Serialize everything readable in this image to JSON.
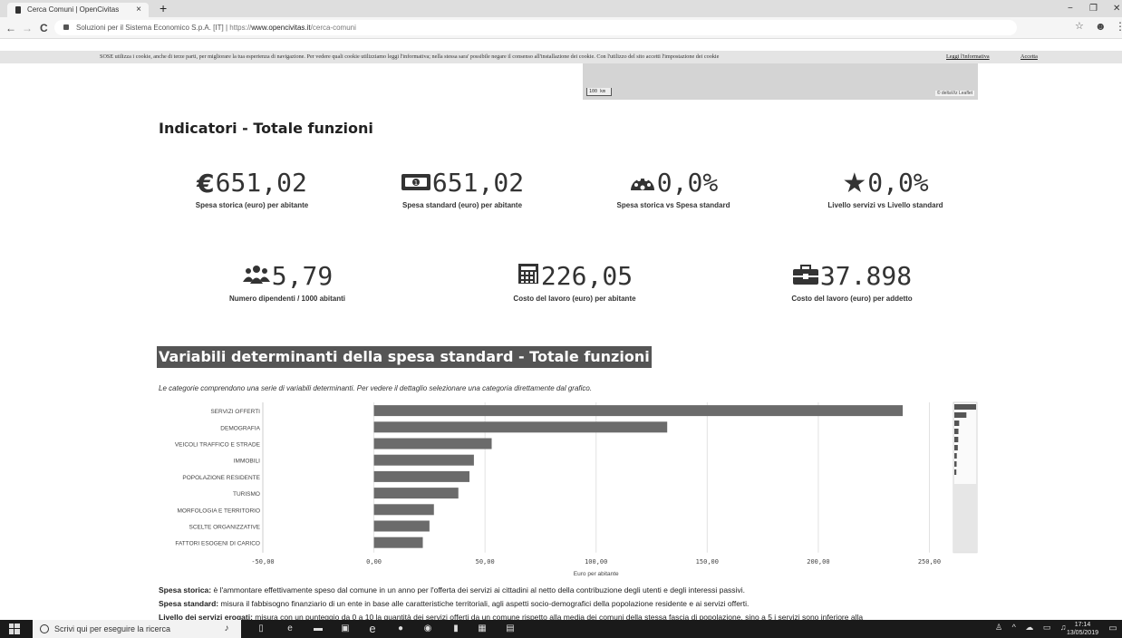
{
  "browser": {
    "tab_title": "Cerca Comuni | OpenCivitas",
    "tab_close": "×",
    "new_tab": "+",
    "min": "−",
    "max": "❐",
    "close": "✕",
    "back": "←",
    "forward": "→",
    "reload": "C",
    "site_identity": "Soluzioni per il Sistema Economico S.p.A. [IT]",
    "separator": " | ",
    "url_prefix": "https://",
    "url_host": "www.opencivitas.it",
    "url_path": "/cerca-comuni",
    "star": "☆",
    "profile": "☻",
    "kebab": "⋮"
  },
  "cookie_bar": {
    "text": "SOSE utilizza i cookie, anche di terze parti, per migliorare la tua esperienza di navigazione. Per vedere quali cookie utilizziamo leggi l'informativa; nella stessa sara' possibile negare il consenso all'installazione dei cookie. Con l'utilizzo del sito accetti l'impostazione dei cookie",
    "link_info": "Leggi l'informativa",
    "link_accept": "Accetta"
  },
  "map": {
    "scale": "100 km",
    "attribution": "© deltaViz Leaflet"
  },
  "indicators": {
    "title": "Indicatori - Totale funzioni",
    "items": [
      {
        "value": "651,02",
        "label": "Spesa storica (euro) per abitante",
        "icon": "euro-icon"
      },
      {
        "value": "651,02",
        "label": "Spesa standard (euro) per abitante",
        "icon": "banknote-icon"
      },
      {
        "value": "0,0%",
        "label": "Spesa storica vs Spesa standard",
        "icon": "gauge-icon"
      },
      {
        "value": "0,0%",
        "label": "Livello servizi vs Livello standard",
        "icon": "star-icon"
      },
      {
        "value": "5,79",
        "label": "Numero dipendenti / 1000 abitanti",
        "icon": "users-icon"
      },
      {
        "value": "226,05",
        "label": "Costo del lavoro (euro) per abitante",
        "icon": "calculator-icon"
      },
      {
        "value": "37.898",
        "label": "Costo del lavoro (euro) per addetto",
        "icon": "briefcase-icon"
      }
    ]
  },
  "variables": {
    "title": "Variabili determinanti della spesa standard - Totale funzioni",
    "description": "Le categorie comprendono una serie di variabili determinanti. Per vedere il dettaglio selezionare una categoria direttamente dal grafico."
  },
  "chart_data": {
    "type": "bar",
    "orientation": "horizontal",
    "categories": [
      "SERVIZI OFFERTI",
      "DEMOGRAFIA",
      "VEICOLI TRAFFICO E STRADE",
      "IMMOBILI",
      "POPOLAZIONE RESIDENTE",
      "TURISMO",
      "MORFOLOGIA E TERRITORIO",
      "SCELTE ORGANIZZATIVE",
      "FATTORI ESOGENI DI CARICO"
    ],
    "values": [
      238,
      132,
      53,
      45,
      43,
      38,
      27,
      25,
      22
    ],
    "xlabel": "Euro per abitante",
    "xlim": [
      -50,
      260
    ],
    "ticks": [
      "-50,00",
      "0,00",
      "50,00",
      "100,00",
      "150,00",
      "200,00",
      "250,00"
    ],
    "tick_values": [
      -50,
      0,
      50,
      100,
      150,
      200,
      250
    ],
    "grid": true
  },
  "definitions": [
    {
      "term": "Spesa storica:",
      "text": " è l'ammontare effettivamente speso dal comune in un anno per l'offerta dei servizi ai cittadini al netto della contribuzione degli utenti e degli interessi passivi."
    },
    {
      "term": "Spesa standard:",
      "text": " misura il fabbisogno finanziario di un ente in base alle caratteristiche territoriali, agli aspetti socio-demografici della popolazione residente e ai servizi offerti."
    },
    {
      "term": "Livello dei servizi erogati:",
      "text": " misura con un punteggio da 0 a 10 la quantità dei servizi offerti da un comune rispetto alla media dei comuni della stessa fascia di popolazione, sino a 5 i servizi sono inferiore alla"
    }
  ],
  "taskbar": {
    "search_placeholder": "Scrivi qui per eseguire la ricerca",
    "time": "17:14",
    "date": "13/05/2019"
  }
}
